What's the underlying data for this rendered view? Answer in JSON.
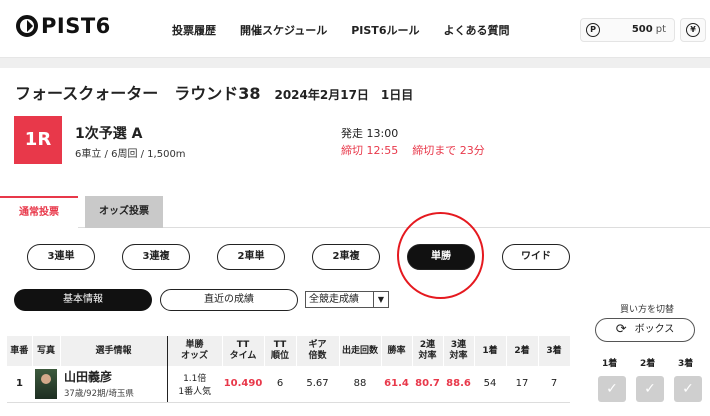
{
  "header": {
    "logo": "PIST6",
    "nav": [
      "投票履歴",
      "開催スケジュール",
      "PIST6ルール",
      "よくある質問"
    ],
    "points_icon": "P",
    "points_value": "500",
    "points_unit": "pt",
    "yen_icon": "¥"
  },
  "race": {
    "title": "フォースクォーター　ラウンド38",
    "date": "2024年2月17日　1日目",
    "badge": "1R",
    "name": "1次予選 A",
    "sub": "6車立 / 6周回 / 1,500m",
    "start": "発走 13:00",
    "deadline": "締切 12:55",
    "remaining": "締切まで 23分"
  },
  "tabs": {
    "normal": "通常投票",
    "odds": "オッズ投票"
  },
  "bet_types": [
    "3連単",
    "3連複",
    "2車単",
    "2車複",
    "単勝",
    "ワイド"
  ],
  "info": {
    "basic": "基本情報",
    "recent": "直近の成績",
    "select_value": "全競走成績"
  },
  "buy": {
    "label": "買い方を切替",
    "box": "ボックス",
    "positions": [
      "1着",
      "2着",
      "3着"
    ]
  },
  "table": {
    "headers": [
      "車番",
      "写真",
      "選手情報",
      "単勝\nオッズ",
      "TT\nタイム",
      "TT\n順位",
      "ギア\n倍数",
      "出走回数",
      "勝率",
      "2連\n対率",
      "3連\n対率",
      "1着",
      "2着",
      "3着"
    ],
    "row": {
      "num": "1",
      "name": "山田義彦",
      "sub": "37歳/92期/埼玉県",
      "odds": "1.1倍",
      "pop": "1番人気",
      "tt_time": "10.490",
      "tt_rank": "6",
      "gear": "5.67",
      "starts": "88",
      "win": "61.4",
      "two": "80.7",
      "three": "88.6",
      "first": "54",
      "second": "17",
      "third": "7"
    }
  }
}
